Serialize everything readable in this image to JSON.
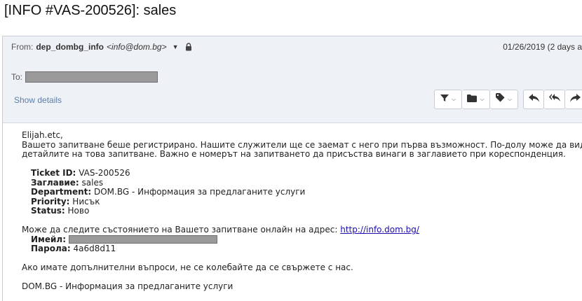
{
  "subject": "[INFO #VAS-200526]: sales",
  "header": {
    "from_label": "From:",
    "from_name": "dep_dombg_info",
    "from_email": "<info@dom.bg>",
    "date": "01/26/2019 (2 days a",
    "to_label": "To:",
    "show_details": "Show details",
    "icons": [
      "filter-icon",
      "folder-icon",
      "tag-icon",
      "reply-icon",
      "reply-all-icon",
      "forward-icon",
      "lock-icon",
      "caret-down-icon",
      "chevron-down-icon"
    ]
  },
  "body": {
    "greeting": "Elijah.etc,",
    "intro_line1": "Вашето запитване беше регистрирано. Нашите служители ще се заемат с него при първа възможност. По-долу може да видите",
    "intro_line2": "детайлите на това запитване. Важно е номерът на запитването да присъства винаги в заглавието при кореспонденция.",
    "fields": [
      {
        "label": "Ticket ID:",
        "value": "VAS-200526"
      },
      {
        "label": "Заглавие:",
        "value": "sales"
      },
      {
        "label": "Department:",
        "value": "DOM.BG - Информация за предлаганите услуги"
      },
      {
        "label": "Priority:",
        "value": "Нисък"
      },
      {
        "label": "Status:",
        "value": "Ново"
      }
    ],
    "track_text": "Може да следите състоянието на Вашето запитване онлайн на адрес:",
    "track_link": "http://info.dom.bg/",
    "email_label": "Имейл:",
    "password_label": "Парола:",
    "password_value": "4a6d8d11",
    "questions": "Ако имате допълнителни въпроси, не се колебайте да се свържете с нас.",
    "signature": "DOM.BG - Информация за предлаганите услуги"
  }
}
